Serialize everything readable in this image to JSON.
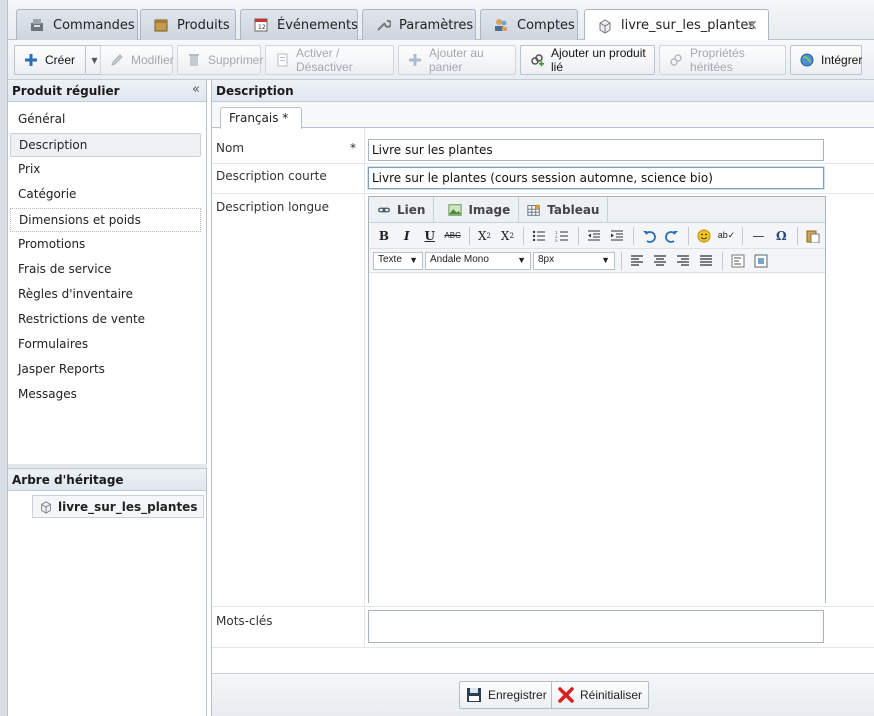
{
  "tabs": [
    {
      "label": "Commandes",
      "icon": "register-icon"
    },
    {
      "label": "Produits",
      "icon": "box-icon"
    },
    {
      "label": "Événements",
      "icon": "calendar-icon"
    },
    {
      "label": "Paramètres",
      "icon": "wrench-icon"
    },
    {
      "label": "Comptes",
      "icon": "users-icon"
    },
    {
      "label": "livre_sur_les_plantes",
      "icon": "cube-icon",
      "active": true
    }
  ],
  "toolbar": {
    "create": "Créer",
    "modify": "Modifier",
    "delete": "Supprimer",
    "toggle": "Activer / Désactiver",
    "add_cart": "Ajouter au panier",
    "add_linked": "Ajouter un produit lié",
    "inherited": "Propriétés héritées",
    "integrate": "Intégrer"
  },
  "left_panel": {
    "title": "Produit régulier",
    "items": [
      "Général",
      "Description",
      "Prix",
      "Catégorie",
      "Dimensions et poids",
      "Promotions",
      "Frais de service",
      "Règles d'inventaire",
      "Restrictions de vente",
      "Formulaires",
      "Jasper Reports",
      "Messages"
    ],
    "selected": "Description"
  },
  "tree": {
    "title": "Arbre d'héritage",
    "node": "livre_sur_les_plantes"
  },
  "main": {
    "title": "Description",
    "lang_tab": "Français *",
    "fields": {
      "name_label": "Nom",
      "required_mark": "*",
      "name_value": "Livre sur les plantes",
      "short_label": "Description courte",
      "short_value": "Livre sur le plantes (cours session automne, science bio)",
      "long_label": "Description longue",
      "keywords_label": "Mots-clés"
    },
    "editor": {
      "tab_link": "Lien",
      "tab_image": "Image",
      "tab_table": "Tableau",
      "format": "Texte",
      "font": "Andale Mono",
      "size": "8px"
    },
    "footer": {
      "save": "Enregistrer",
      "reset": "Réinitialiser"
    }
  },
  "colors": {
    "accent": "#2a6ebb",
    "danger": "#d62020",
    "success": "#3c9b2e"
  }
}
